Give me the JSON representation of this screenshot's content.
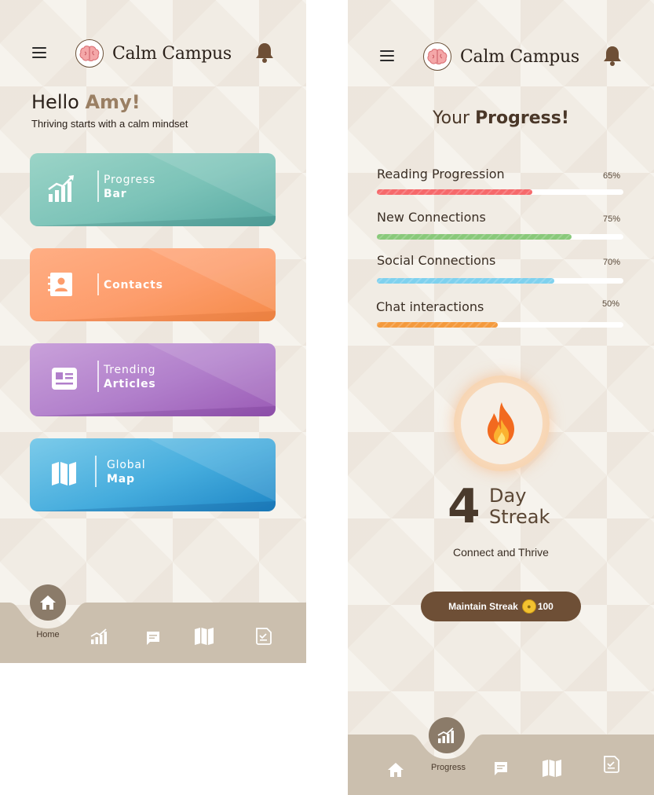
{
  "app": {
    "name": "Calm Campus"
  },
  "home": {
    "greeting": "Hello",
    "user_name": "Amy!",
    "tagline": "Thriving starts with a calm mindset",
    "tiles": [
      {
        "line1": "Progress",
        "line2": "Bar",
        "icon": "bar-chart-icon",
        "color": "#7fc6bb"
      },
      {
        "line1": "",
        "line2": "Contacts",
        "icon": "contacts-icon",
        "color": "#fc9f6d"
      },
      {
        "line1": "Trending",
        "line2": "Articles",
        "icon": "article-icon",
        "color": "#b17fcb"
      },
      {
        "line1": "Global",
        "line2": "Map",
        "icon": "map-icon",
        "color": "#3aa6da"
      }
    ],
    "nav": {
      "active_label": "Home"
    }
  },
  "progress": {
    "title_prefix": "Your",
    "title_bold": "Progress!",
    "items": [
      {
        "label": "Reading Progression",
        "percent_text": "65%",
        "value": 0.63,
        "color": "#f6696b"
      },
      {
        "label": "New Connections",
        "percent_text": "75%",
        "value": 0.79,
        "color": "#89c97a"
      },
      {
        "label": "Social Connections",
        "percent_text": "70%",
        "value": 0.72,
        "color": "#7fd1ee"
      },
      {
        "label": "Chat interactions",
        "percent_text": "50%",
        "value": 0.49,
        "color": "#f49a3d"
      }
    ],
    "streak": {
      "number": "4",
      "line1": "Day",
      "line2": "Streak",
      "subtitle": "Connect and Thrive"
    },
    "maintain_button": {
      "label": "Maintain Streak",
      "coins": "100"
    },
    "nav": {
      "active_label": "Progress"
    }
  },
  "colors": {
    "brown": "#6e4f36",
    "nav_bg": "#cbbfae",
    "bg": "#f1ece4"
  }
}
